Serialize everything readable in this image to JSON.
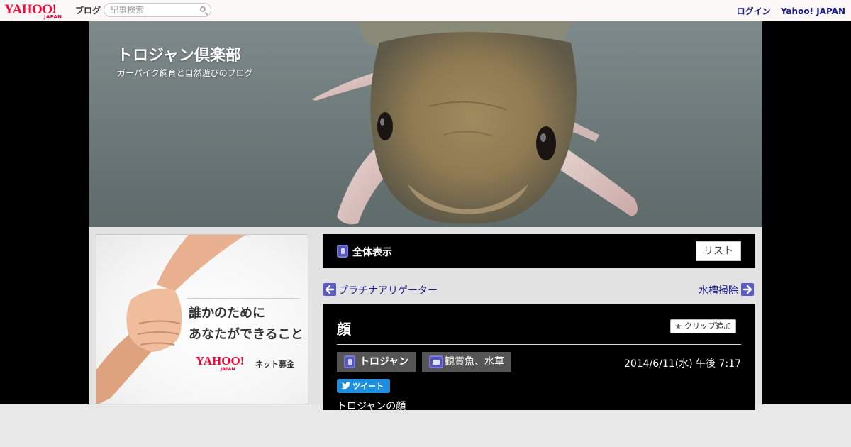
{
  "topbar": {
    "logo": {
      "main": "YAHOO!",
      "sub": "JAPAN",
      "service": "ブログ"
    },
    "search": {
      "placeholder": "記事検索"
    },
    "links": {
      "login": "ログイン",
      "yahoo": "Yahoo! JAPAN"
    }
  },
  "header": {
    "title": "トロジャン倶楽部",
    "subtitle": "ガーパイク飼育と自然遊びのブログ"
  },
  "ad": {
    "line1": "誰かのために",
    "line2": "あなたができること",
    "logo_main": "YAHOO!",
    "logo_sub": "JAPAN",
    "service": "ネット募金"
  },
  "allbar": {
    "label": "全体表示",
    "list_button": "リスト"
  },
  "pager": {
    "prev": "プラチナアリゲーター",
    "next": "水槽掃除"
  },
  "article": {
    "title": "顔",
    "clip_button": "クリップ追加",
    "author": "トロジャン",
    "category": "観賞魚、水草",
    "date": "2014/6/11(水) 午後 7:17",
    "tweet": "ツイート",
    "excerpt": "トロジャンの顔"
  },
  "colors": {
    "link": "#1a1a8c",
    "yahoo_red": "#ff0033",
    "icon_blue": "#5555bb",
    "tweet_blue": "#1d8fe0"
  }
}
